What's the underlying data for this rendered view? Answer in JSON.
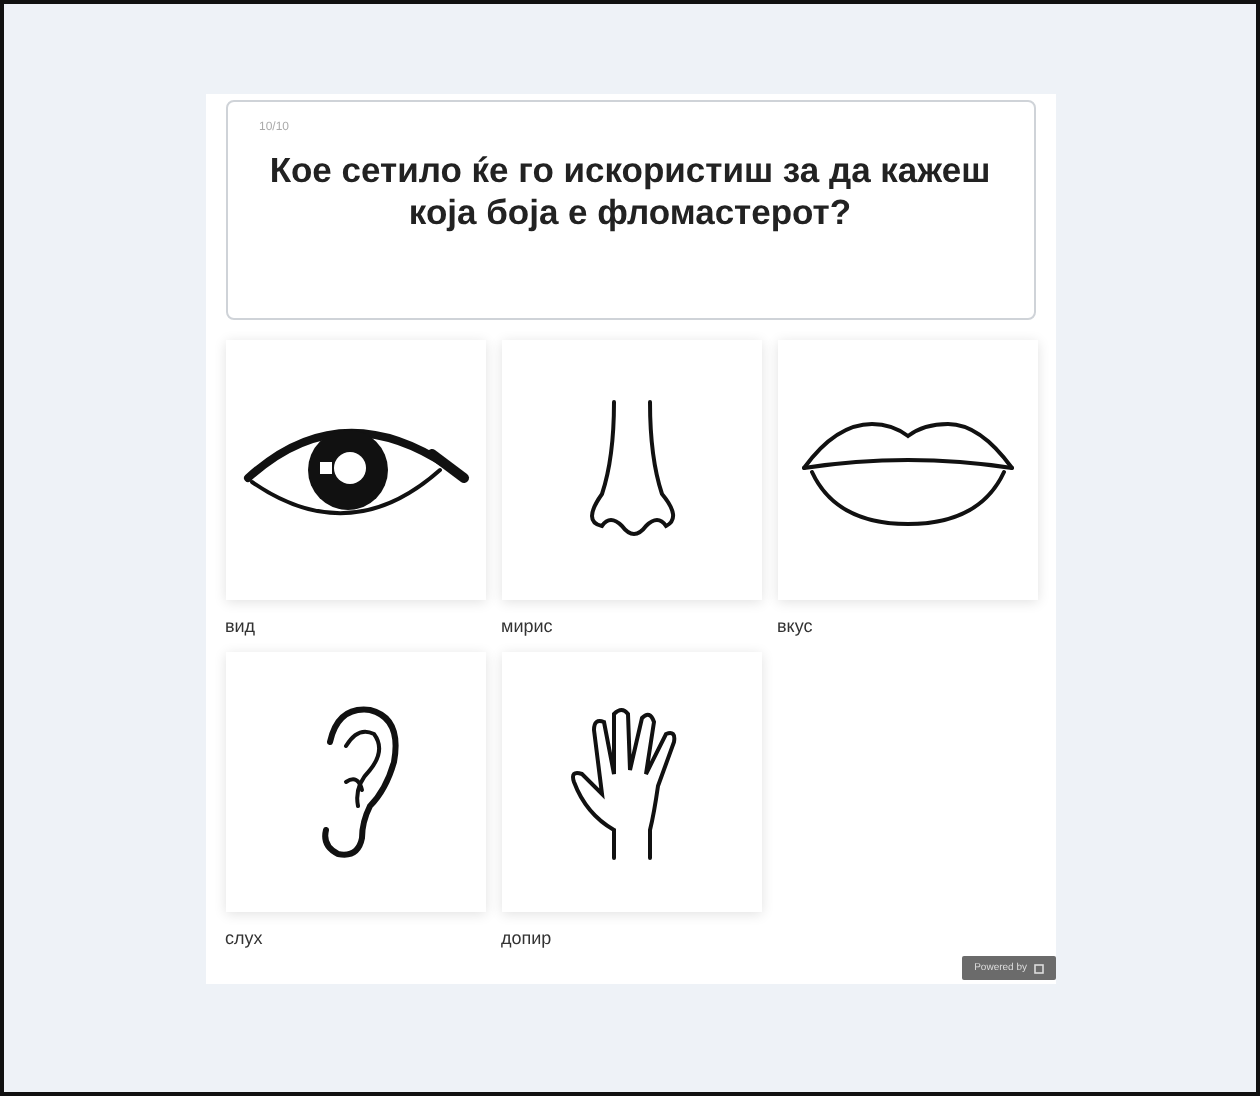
{
  "quiz": {
    "counter": "10/10",
    "question": "Кое сетило ќе го искористиш за да кажеш која боја е фломастерот?",
    "options": [
      {
        "kind": "eye",
        "label": "вид"
      },
      {
        "kind": "nose",
        "label": "мирис"
      },
      {
        "kind": "lips",
        "label": "вкус"
      },
      {
        "kind": "ear",
        "label": "слух"
      },
      {
        "kind": "hand",
        "label": "допир"
      }
    ],
    "badge": "Powered by"
  }
}
